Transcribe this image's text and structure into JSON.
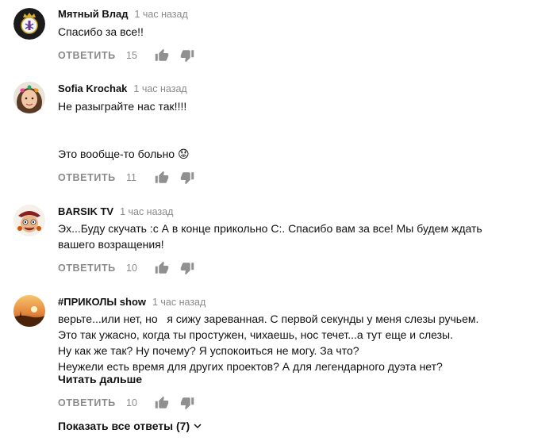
{
  "comments": [
    {
      "author": "Мятный Влад",
      "time": "1 час назад",
      "lines": [
        "Спасибо за все!!"
      ],
      "reply_label": "ОТВЕТИТЬ",
      "likes": "15",
      "avatar": "real-madrid-crest-icon"
    },
    {
      "author": "Sofia Krochak",
      "time": "1 час назад",
      "lines": [
        "Не разыграйте нас так!!!!",
        "",
        "",
        "Это вообще-то больно 😟"
      ],
      "reply_label": "ОТВЕТИТЬ",
      "likes": "11",
      "avatar": "girl-portrait-icon"
    },
    {
      "author": "BARSIK TV",
      "time": "1 час назад",
      "lines": [
        "Эх...Буду скучать :с А в конце прикольно С:. Спасибо вам за все! Мы будем ждать",
        "вашего возращения!"
      ],
      "reply_label": "ОТВЕТИТЬ",
      "likes": "10",
      "avatar": "cartoon-character-icon"
    },
    {
      "author": "#ПРИКОЛЫ show",
      "time": "1 час назад",
      "lines": [
        "верьте...или нет, но   я сижу зареванная. С первой секунды у меня слезы ручьем.",
        "Это так ужасно, когда ты простужен, чихаешь, нос течет...а тут еще и слезы.",
        "Ну как же так? Ну почему? Я успокоиться не могу. За что?",
        "Неужели есть время для других проектов? А для легендарного дуэта нет?"
      ],
      "read_more": "Читать дальше",
      "reply_label": "ОТВЕТИТЬ",
      "likes": "10",
      "avatar": "sunset-landscape-icon"
    }
  ],
  "show_replies_label": "Показать все ответы (7)",
  "icons": {
    "like": "thumb-up-icon",
    "dislike": "thumb-down-icon",
    "expand": "chevron-down-icon"
  },
  "colors": {
    "text": "#111111",
    "meta": "#8a8a8a",
    "icon": "#909090"
  }
}
